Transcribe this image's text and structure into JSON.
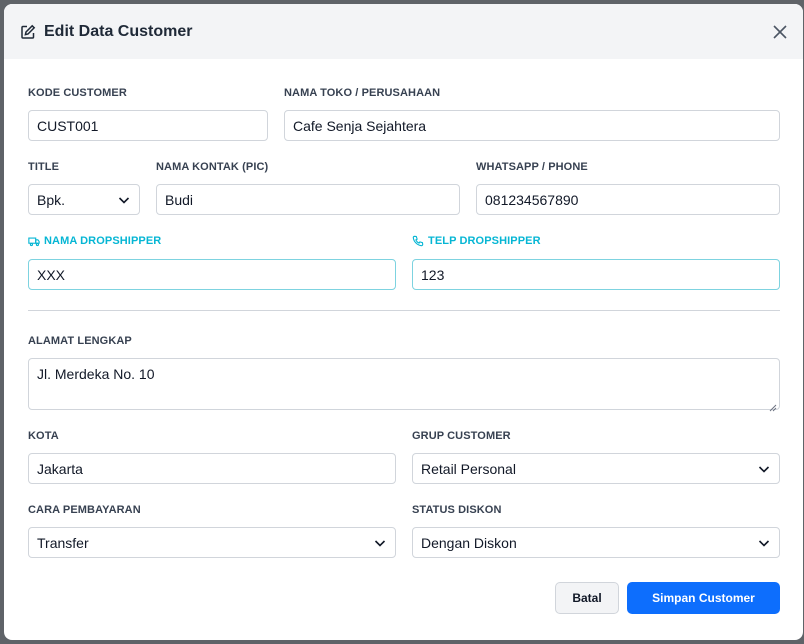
{
  "modal": {
    "title": "Edit Data Customer"
  },
  "fields": {
    "kode_customer": {
      "label": "KODE CUSTOMER",
      "value": "CUST001"
    },
    "nama_toko": {
      "label": "NAMA TOKO / PERUSAHAAN",
      "value": "Cafe Senja Sejahtera"
    },
    "title": {
      "label": "TITLE",
      "value": "Bpk."
    },
    "nama_kontak": {
      "label": "NAMA KONTAK (PIC)",
      "value": "Budi"
    },
    "whatsapp": {
      "label": "WHATSAPP / PHONE",
      "value": "081234567890"
    },
    "nama_dropshipper": {
      "label": "NAMA DROPSHIPPER",
      "value": "XXX"
    },
    "telp_dropshipper": {
      "label": "TELP DROPSHIPPER",
      "value": "123"
    },
    "alamat": {
      "label": "ALAMAT LENGKAP",
      "value": "Jl. Merdeka No. 10"
    },
    "kota": {
      "label": "KOTA",
      "value": "Jakarta"
    },
    "grup_customer": {
      "label": "GRUP CUSTOMER",
      "value": "Retail Personal"
    },
    "cara_pembayaran": {
      "label": "CARA PEMBAYARAN",
      "value": "Transfer"
    },
    "status_diskon": {
      "label": "STATUS DISKON",
      "value": "Dengan Diskon"
    }
  },
  "buttons": {
    "cancel": "Batal",
    "save": "Simpan Customer"
  },
  "colors": {
    "accent": "#0d6efd",
    "dropshipper": "#06b6d4"
  }
}
